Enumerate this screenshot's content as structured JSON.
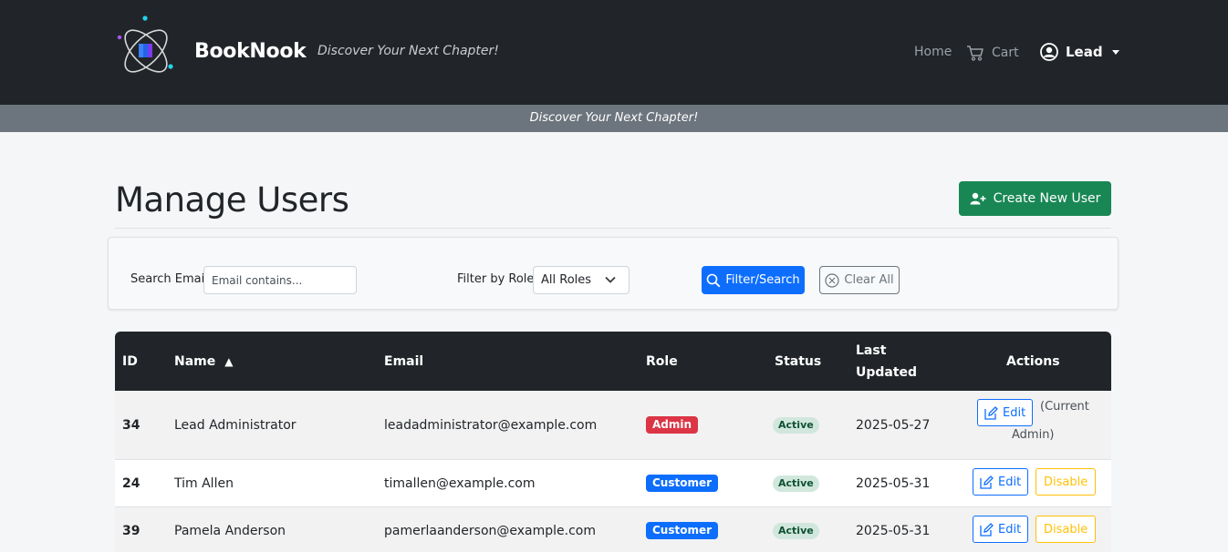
{
  "navbar": {
    "brand": "BookNook",
    "tagline": "Discover Your Next Chapter!",
    "links": {
      "home": "Home",
      "cart": "Cart",
      "user": "Lead"
    }
  },
  "banner": {
    "text": "Discover Your Next Chapter!"
  },
  "page": {
    "title": "Manage Users",
    "create_button": "Create New User"
  },
  "filters": {
    "search_label": "Search Email",
    "search_placeholder": "Email contains...",
    "search_value": "",
    "role_label": "Filter by Role",
    "role_selected": "All Roles",
    "filter_button": "Filter/Search",
    "clear_button": "Clear All"
  },
  "table": {
    "headers": {
      "id": "ID",
      "name": "Name",
      "name_sort": "▲",
      "email": "Email",
      "role": "Role",
      "status": "Status",
      "last_updated_1": "Last",
      "last_updated_2": "Updated",
      "actions": "Actions"
    },
    "rows": [
      {
        "id": "34",
        "name": "Lead Administrator",
        "email": "leadadministrator@example.com",
        "role": "Admin",
        "status": "Active",
        "updated": "2025-05-27",
        "edit": "Edit",
        "note_1": "(Current",
        "note_2": "Admin)"
      },
      {
        "id": "24",
        "name": "Tim Allen",
        "email": "timallen@example.com",
        "role": "Customer",
        "status": "Active",
        "updated": "2025-05-31",
        "edit": "Edit",
        "disable": "Disable"
      },
      {
        "id": "39",
        "name": "Pamela Anderson",
        "email": "pamerlaanderson@example.com",
        "role": "Customer",
        "status": "Active",
        "updated": "2025-05-31",
        "edit": "Edit",
        "disable": "Disable"
      }
    ]
  },
  "colors": {
    "navbar": "#212529",
    "banner": "#6c757d",
    "success": "#198754",
    "primary": "#0d6efd",
    "danger": "#dc3545",
    "warning": "#ffc107"
  },
  "icons": {
    "logo": "booknook-atom-logo",
    "cart": "cart-icon",
    "user": "user-circle-icon",
    "create": "person-plus-icon",
    "filter": "search-icon",
    "clear": "x-circle-icon",
    "edit": "pencil-square-icon",
    "select": "chevron-down-icon"
  }
}
